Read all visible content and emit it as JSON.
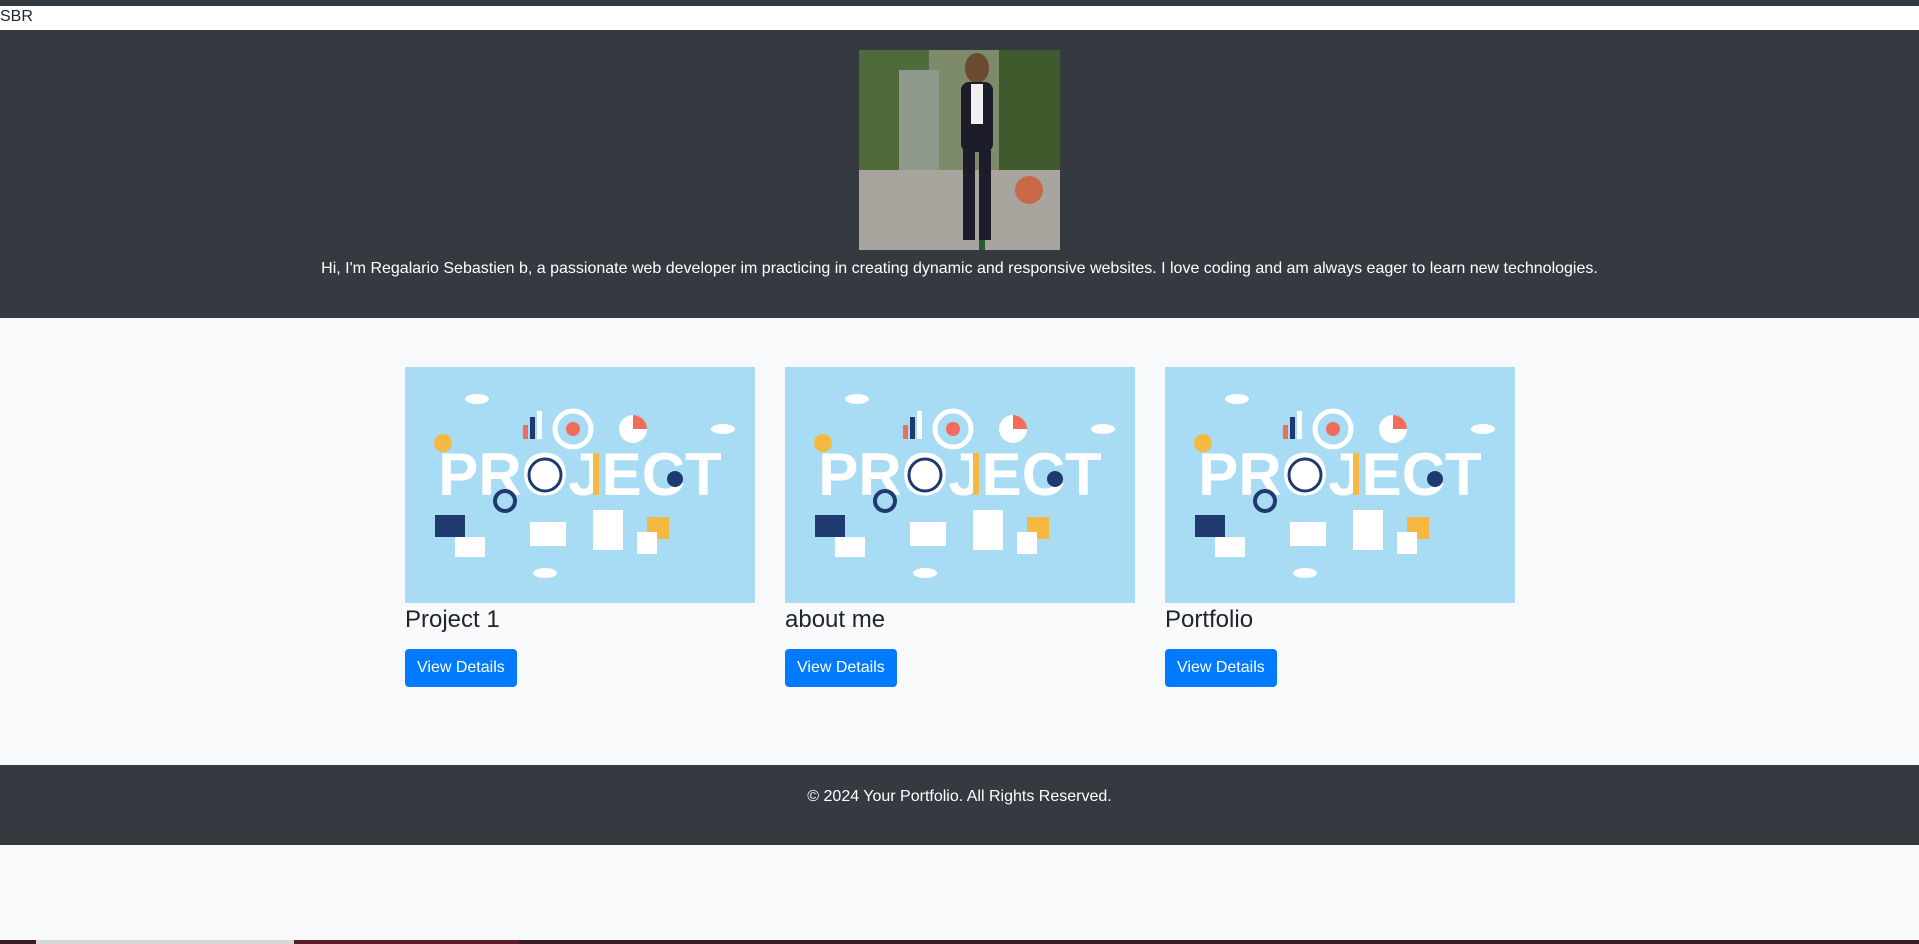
{
  "brand": {
    "text": "SBR"
  },
  "hero": {
    "avatar_alt": "profile photo",
    "bio": "Hi, I'm Regalario Sebastien b, a passionate web developer im practicing in creating dynamic and responsive websites. I love coding and am always eager to learn new technologies."
  },
  "projects": [
    {
      "image_text": "PROJECT",
      "title": "Project 1",
      "button": "View Details"
    },
    {
      "image_text": "PROJECT",
      "title": "about me",
      "button": "View Details"
    },
    {
      "image_text": "PROJECT",
      "title": "Portfolio",
      "button": "View Details"
    }
  ],
  "footer": {
    "text": "© 2024 Your Portfolio. All Rights Reserved."
  },
  "colors": {
    "header_bg": "#343a40",
    "page_bg": "#f8f9fa",
    "button_bg": "#007bff",
    "thumb_bg": "#a8dcf5"
  }
}
